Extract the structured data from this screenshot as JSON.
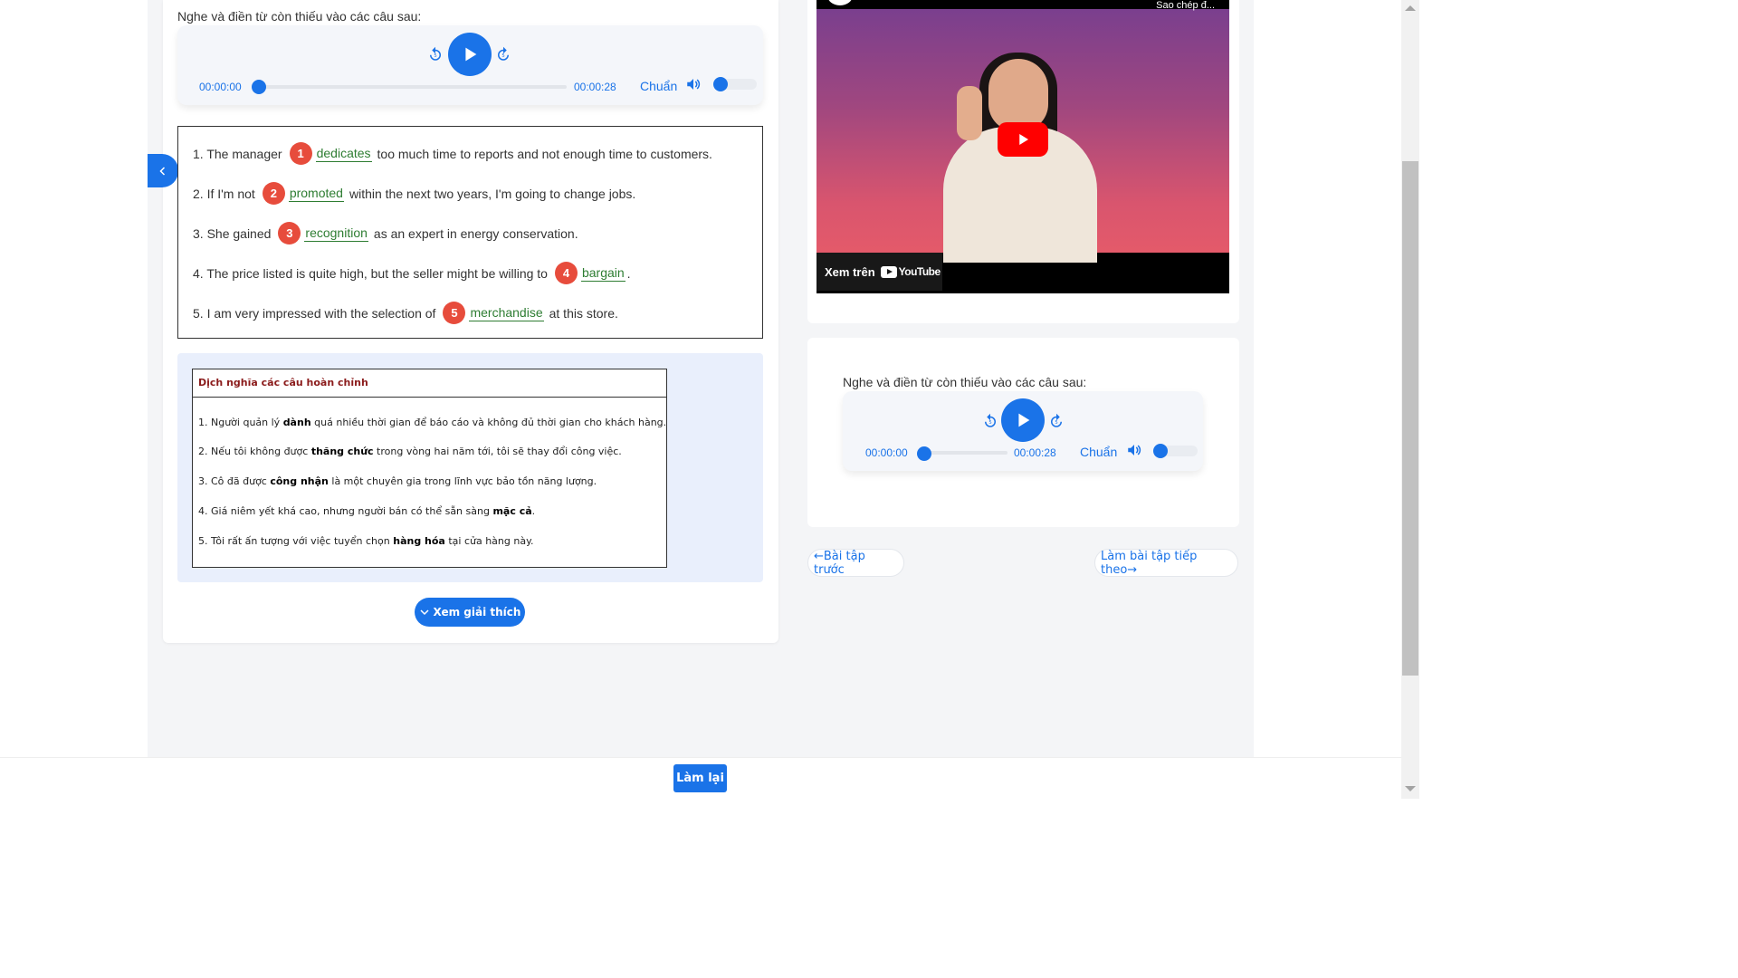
{
  "instruction": "Nghe và điền từ còn thiếu vào các câu sau:",
  "player": {
    "current_time": "00:00:00",
    "duration": "00:00:28",
    "speed_label": "Chuẩn",
    "progress": 0,
    "volume": 0,
    "icons": {
      "rewind": "replay-5-icon",
      "play": "play-icon",
      "forward": "forward-5-icon",
      "volume": "volume-icon"
    }
  },
  "questions": [
    {
      "prefix": "1. The manager",
      "number": "1",
      "answer": "dedicates",
      "suffix": "too much time to reports and not enough time to customers."
    },
    {
      "prefix": "2. If I'm not",
      "number": "2",
      "answer": "promoted",
      "suffix": "within the next two years, I'm going to change jobs."
    },
    {
      "prefix": "3. She gained",
      "number": "3",
      "answer": "recognition",
      "suffix": "as an expert in energy conservation."
    },
    {
      "prefix": "4. The price listed is quite high, but the seller might be willing to",
      "number": "4",
      "answer": "bargain",
      "suffix": "."
    },
    {
      "prefix": "5. I am very impressed with the selection of",
      "number": "5",
      "answer": "merchandise",
      "suffix": "at this store."
    }
  ],
  "translation": {
    "heading": "Dịch nghĩa các câu hoàn chỉnh",
    "lines": [
      {
        "before": "1. Người quản lý ",
        "bold": "dành",
        "after": " quá nhiều thời gian để báo cáo và không đủ thời gian cho khách hàng."
      },
      {
        "before": "2. Nếu tôi không được ",
        "bold": "thăng chức",
        "after": " trong vòng hai năm tới, tôi sẽ thay đổi công việc."
      },
      {
        "before": "3. Cô đã được ",
        "bold": "công nhận",
        "after": " là một chuyên gia trong lĩnh vực bảo tồn năng lượng."
      },
      {
        "before": "4. Giá niêm yết khá cao, nhưng người bán có thể sẵn sàng ",
        "bold": "mặc cả",
        "after": "."
      },
      {
        "before": "5. Tôi rất ấn tượng với việc tuyển chọn ",
        "bold": "hàng hóa",
        "after": " tại cửa hàng này."
      }
    ]
  },
  "explain_button": "Xem giải thích",
  "video": {
    "top_text": "Sao chép đ...",
    "watch_on": "Xem trên",
    "platform": "YouTube"
  },
  "nav": {
    "prev": "←Bài tập trước",
    "next": "Làm bài tập tiếp theo→"
  },
  "retry_button": "Làm lại",
  "colors": {
    "accent": "#1a73e8",
    "badge": "#e74c3c",
    "answer": "#2e7d32",
    "translation_heading": "#8b1c1c"
  }
}
